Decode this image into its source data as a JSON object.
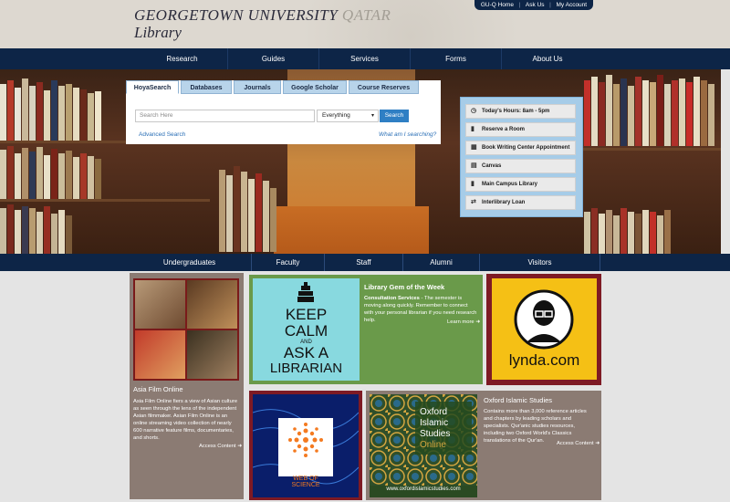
{
  "header": {
    "logo_main": "GEORGETOWN UNIVERSITY",
    "logo_qatar": "QATAR",
    "logo_sub": "Library",
    "util_links": [
      "GU-Q Home",
      "Ask Us",
      "My Account"
    ]
  },
  "topnav": [
    "Research",
    "Guides",
    "Services",
    "Forms",
    "About Us"
  ],
  "search": {
    "tabs": [
      "HoyaSearch",
      "Databases",
      "Journals",
      "Google Scholar",
      "Course Reserves"
    ],
    "placeholder": "Search Here",
    "scope_selected": "Everything",
    "button": "Search",
    "advanced": "Advanced Search",
    "what": "What am I searching?"
  },
  "quick_links": [
    {
      "icon": "clock-icon",
      "glyph": "◷",
      "label": "Today's Hours: 8am - 5pm"
    },
    {
      "icon": "door-icon",
      "glyph": "▮",
      "label": "Reserve a Room"
    },
    {
      "icon": "calendar-icon",
      "glyph": "▦",
      "label": "Book Writing Center Appointment"
    },
    {
      "icon": "canvas-icon",
      "glyph": "▤",
      "label": "Canvas"
    },
    {
      "icon": "book-icon",
      "glyph": "▮",
      "label": "Main Campus Library"
    },
    {
      "icon": "exchange-icon",
      "glyph": "⇄",
      "label": "Interlibrary Loan"
    }
  ],
  "audience": [
    "Undergraduates",
    "Faculty",
    "Staff",
    "Alumni",
    "Visitors"
  ],
  "tiles": {
    "asia": {
      "title": "Asia Film Online",
      "text": "Asia Film Online fiers a view of Asian culture as seen through the lens of the independent Asian filmmaker. Asian Film Online is an online streaming video collection of nearly 600 narrative feature films, documentaries, and shorts.",
      "link": "Access Content"
    },
    "gem": {
      "title": "Library Gem of the Week",
      "text_bold": "Consultation Services",
      "text": " - The semester is moving along quickly. Remember to connect with your personal librarian if you need research help.",
      "link": "Learn more",
      "poster_lines": [
        "KEEP",
        "CALM",
        "AND",
        "ASK A",
        "LIBRARIAN"
      ]
    },
    "lynda": {
      "label": "lynda.com"
    },
    "wos": {
      "label": "WEB OF SCIENCE"
    },
    "oxford": {
      "title": "Oxford Islamic Studies",
      "text": "Contains more than 3,000 reference articles and chapters by leading scholars and specialists. Qur'anic studies resources, including two Oxford World's Classics translations of the Qur'an.",
      "link": "Access Content",
      "cover_lines": [
        "Oxford",
        "Islamic",
        "Studies",
        "Online"
      ],
      "cover_url": "www.oxfordislamicstudies.com"
    }
  },
  "colors": {
    "navy": "#0d2547",
    "tile_taupe": "#8b7b73",
    "tile_green": "#6a9a4a",
    "tile_maroon": "#7e1a24",
    "search_blue": "#2f7fc4",
    "lynda_yellow": "#f5c015"
  }
}
